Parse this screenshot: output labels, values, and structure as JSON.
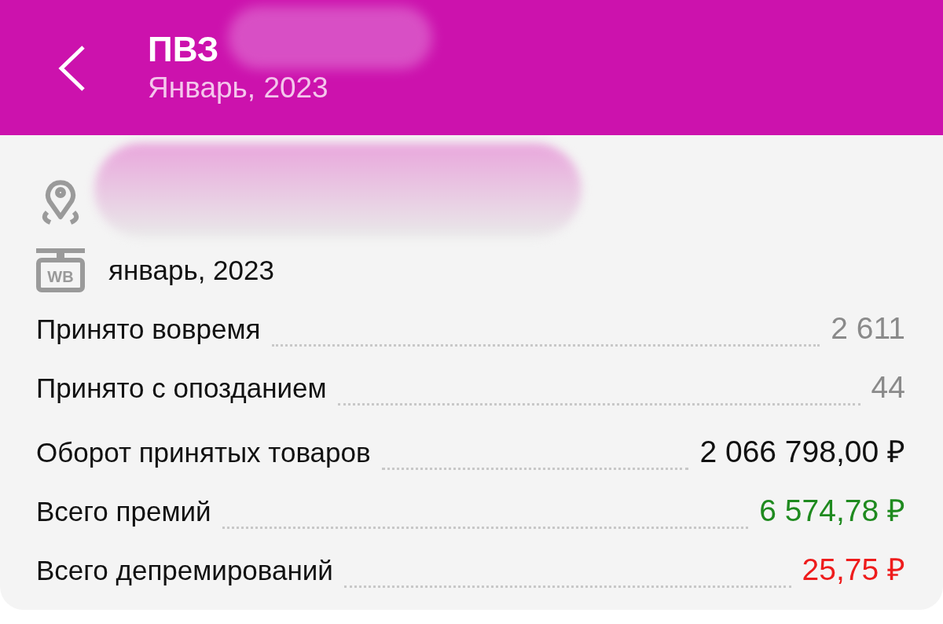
{
  "header": {
    "title": "ПВЗ",
    "subtitle": "Январь, 2023"
  },
  "info": {
    "period_badge": "WB",
    "period": "январь, 2023"
  },
  "stats": [
    {
      "label": "Принято вовремя",
      "value": "2 611",
      "color": "#8a8a8a"
    },
    {
      "label": "Принято с опозданием",
      "value": "44",
      "color": "#8a8a8a"
    },
    {
      "label": "Оборот принятых товаров",
      "value": "2 066 798,00 ₽",
      "color": "#111111"
    },
    {
      "label": "Всего премий",
      "value": "6 574,78 ₽",
      "color": "#1f8a1f"
    },
    {
      "label": "Всего депремирований",
      "value": "25,75 ₽",
      "color": "#ee1c1c"
    }
  ]
}
